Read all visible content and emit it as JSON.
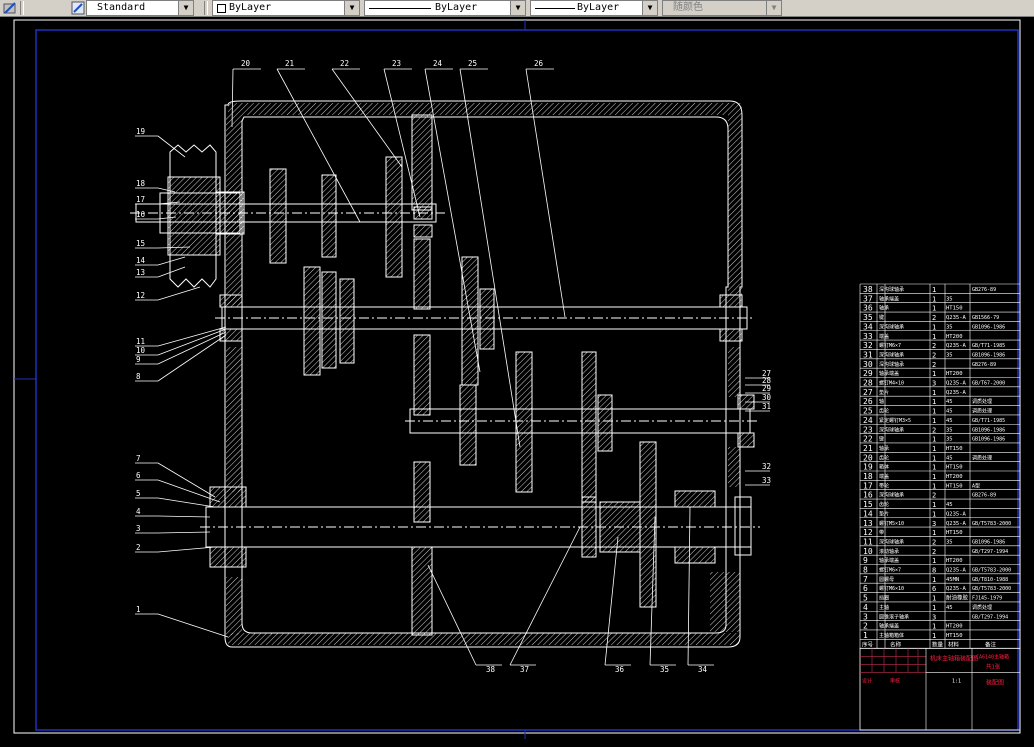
{
  "toolbar": {
    "text_style": "Standard",
    "layer_color": "ByLayer",
    "linetype": "ByLayer",
    "lineweight": "ByLayer",
    "plot_style": "随颜色"
  },
  "drawing": {
    "part_labels_top": [
      "20",
      "21",
      "22",
      "23",
      "24",
      "25",
      "26"
    ],
    "part_labels_left": [
      "19",
      "18",
      "17",
      "16",
      "15",
      "14",
      "13",
      "12",
      "11",
      "10",
      "9",
      "8",
      "7",
      "6",
      "5",
      "4",
      "3",
      "2",
      "1"
    ],
    "part_labels_right": [
      "27",
      "28",
      "29",
      "30",
      "31",
      "32",
      "33"
    ],
    "part_labels_bottom": [
      "38",
      "37",
      "36",
      "35",
      "34"
    ],
    "bom_rows": [
      {
        "no": "38",
        "name": "深沟球轴承",
        "qty": "1",
        "mat": "",
        "std": "GB276-89"
      },
      {
        "no": "37",
        "name": "轴承端盖",
        "qty": "1",
        "mat": "35",
        "std": ""
      },
      {
        "no": "36",
        "name": "轴承",
        "qty": "1",
        "mat": "HT150",
        "std": ""
      },
      {
        "no": "35",
        "name": "键",
        "qty": "2",
        "mat": "Q235-A",
        "std": "GB1566-79"
      },
      {
        "no": "34",
        "name": "深沟球轴承",
        "qty": "1",
        "mat": "35",
        "std": "GB1096-1986"
      },
      {
        "no": "33",
        "name": "端盖",
        "qty": "1",
        "mat": "HT200",
        "std": ""
      },
      {
        "no": "32",
        "name": "螺钉M6×7",
        "qty": "2",
        "mat": "Q235-A",
        "std": "GB/T71-1985"
      },
      {
        "no": "31",
        "name": "深沟球轴承",
        "qty": "2",
        "mat": "35",
        "std": "GB1096-1986"
      },
      {
        "no": "30",
        "name": "深沟球轴承",
        "qty": "2",
        "mat": "",
        "std": "GB276-89"
      },
      {
        "no": "29",
        "name": "轴承端盖",
        "qty": "1",
        "mat": "HT200",
        "std": ""
      },
      {
        "no": "28",
        "name": "螺钉M4×10",
        "qty": "3",
        "mat": "Q235-A",
        "std": "GB/T67-2000"
      },
      {
        "no": "27",
        "name": "垫片",
        "qty": "1",
        "mat": "Q235-A",
        "std": ""
      },
      {
        "no": "26",
        "name": "轴",
        "qty": "1",
        "mat": "45",
        "std": "调质处理"
      },
      {
        "no": "25",
        "name": "齿轮",
        "qty": "1",
        "mat": "45",
        "std": "调质处理"
      },
      {
        "no": "24",
        "name": "紧定螺钉M3×5",
        "qty": "1",
        "mat": "45",
        "std": "GB/T71-1985"
      },
      {
        "no": "23",
        "name": "深沟球轴承",
        "qty": "2",
        "mat": "35",
        "std": "GB1096-1986"
      },
      {
        "no": "22",
        "name": "键",
        "qty": "1",
        "mat": "35",
        "std": "GB1096-1986"
      },
      {
        "no": "21",
        "name": "轴承",
        "qty": "1",
        "mat": "HT150",
        "std": ""
      },
      {
        "no": "20",
        "name": "齿轮",
        "qty": "1",
        "mat": "45",
        "std": "调质处理"
      },
      {
        "no": "19",
        "name": "箱体",
        "qty": "1",
        "mat": "HT150",
        "std": ""
      },
      {
        "no": "18",
        "name": "端盖",
        "qty": "1",
        "mat": "HT200",
        "std": ""
      },
      {
        "no": "17",
        "name": "带轮",
        "qty": "1",
        "mat": "HT150",
        "std": "A型"
      },
      {
        "no": "16",
        "name": "深沟球轴承",
        "qty": "2",
        "mat": "",
        "std": "GB276-89"
      },
      {
        "no": "15",
        "name": "齿轮",
        "qty": "1",
        "mat": "45",
        "std": ""
      },
      {
        "no": "14",
        "name": "垫片",
        "qty": "1",
        "mat": "Q235-A",
        "std": ""
      },
      {
        "no": "13",
        "name": "螺钉M5×10",
        "qty": "3",
        "mat": "Q235-A",
        "std": "GB/T5783-2000"
      },
      {
        "no": "12",
        "name": "带",
        "qty": "1",
        "mat": "HT150",
        "std": ""
      },
      {
        "no": "11",
        "name": "深沟球轴承",
        "qty": "2",
        "mat": "35",
        "std": "GB1096-1986"
      },
      {
        "no": "10",
        "name": "滚动轴承",
        "qty": "2",
        "mat": "",
        "std": "GB/T297-1994"
      },
      {
        "no": "9",
        "name": "轴承端盖",
        "qty": "1",
        "mat": "HT200",
        "std": ""
      },
      {
        "no": "8",
        "name": "螺钉M6×7",
        "qty": "8",
        "mat": "Q235-A",
        "std": "GB/T5783-2000"
      },
      {
        "no": "7",
        "name": "圆螺母",
        "qty": "1",
        "mat": "45MN",
        "std": "GB/T810-1988"
      },
      {
        "no": "6",
        "name": "螺钉M6×10",
        "qty": "6",
        "mat": "Q235-A",
        "std": "GB/T5783-2000"
      },
      {
        "no": "5",
        "name": "挡圈",
        "qty": "1",
        "mat": "耐油橡胶",
        "std": "FJ145-1979"
      },
      {
        "no": "4",
        "name": "主轴",
        "qty": "1",
        "mat": "45",
        "std": "调质处理"
      },
      {
        "no": "3",
        "name": "圆锥滚子轴承",
        "qty": "3",
        "mat": "",
        "std": "GB/T297-1994"
      },
      {
        "no": "2",
        "name": "轴承端盖",
        "qty": "1",
        "mat": "HT200",
        "std": ""
      },
      {
        "no": "1",
        "name": "主轴箱箱体",
        "qty": "1",
        "mat": "HT150",
        "std": ""
      }
    ],
    "bom_header": {
      "no": "序号",
      "name": "名称",
      "qty": "数量",
      "mat": "材料",
      "std": "备注"
    },
    "title_block": {
      "title": "机床主轴箱装配图",
      "drawing_no": "CA6140主轴箱",
      "sheet": "共1张",
      "company": "装配图",
      "designer": "设计",
      "checker": "审核",
      "scale": "1:1"
    }
  }
}
